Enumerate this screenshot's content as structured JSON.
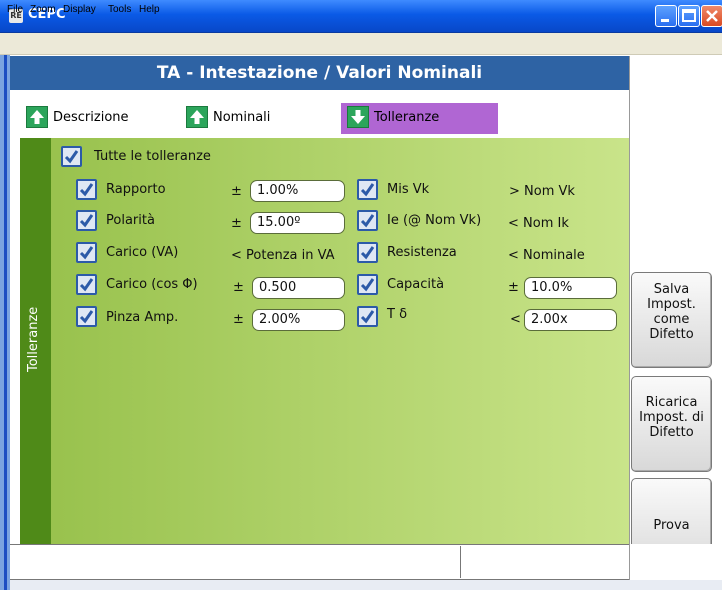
{
  "window": {
    "title": "CEPC",
    "icon_text": "RE"
  },
  "menu": [
    "File",
    "Zoom",
    "Display",
    "Tools",
    "Help"
  ],
  "header": {
    "title": "TA - Intestazione / Valori Nominali"
  },
  "tabs": [
    {
      "label": "Descrizione",
      "icon": "arrow-up-icon"
    },
    {
      "label": "Nominali",
      "icon": "arrow-up-icon"
    },
    {
      "label": "Tolleranze",
      "icon": "arrow-down-icon"
    }
  ],
  "side_tab": {
    "label": "Tolleranze"
  },
  "all_tolerances": {
    "label": "Tutte le tolleranze",
    "checked": true
  },
  "left_rows": [
    {
      "label": "Rapporto",
      "op": "±",
      "value": "1.00%"
    },
    {
      "label": "Polarità",
      "op": "±",
      "value": "15.00º"
    },
    {
      "label": "Carico (VA)",
      "op": "< Potenza in VA",
      "value": ""
    },
    {
      "label": "Carico (cos Φ)",
      "op": "±",
      "value": "0.500"
    },
    {
      "label": "Pinza Amp.",
      "op": "±",
      "value": "2.00%"
    }
  ],
  "right_rows": [
    {
      "label": "Mis Vk",
      "op": "> Nom Vk",
      "value": ""
    },
    {
      "label": "Ie (@ Nom Vk)",
      "op": "< Nom Ik",
      "value": ""
    },
    {
      "label": "Resistenza",
      "op": "< Nominale",
      "value": ""
    },
    {
      "label": "Capacità",
      "op": "±",
      "value": "10.0%"
    },
    {
      "label": "T δ",
      "op": "<",
      "value": "2.00x"
    }
  ],
  "buttons": {
    "save_defaults": "Salva Impost. come Difetto",
    "reload_defaults": "Ricarica Impost. di Difetto",
    "test": "Prova"
  },
  "colors": {
    "header_bg": "#2e63a4",
    "content_green": "#96c04a",
    "side_tab_green": "#4f8a18",
    "active_tab": "#b066d3"
  }
}
